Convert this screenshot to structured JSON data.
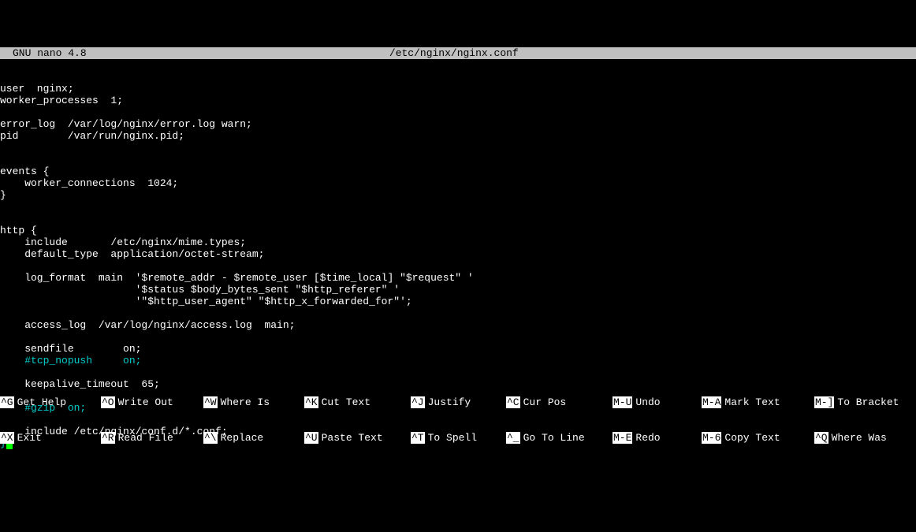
{
  "header": {
    "app": "GNU nano 4.8",
    "filename": "/etc/nginx/nginx.conf"
  },
  "lines": [
    {
      "t": "user  nginx;"
    },
    {
      "t": "worker_processes  1;"
    },
    {
      "t": ""
    },
    {
      "t": "error_log  /var/log/nginx/error.log warn;"
    },
    {
      "t": "pid        /var/run/nginx.pid;"
    },
    {
      "t": ""
    },
    {
      "t": ""
    },
    {
      "t": "events {"
    },
    {
      "t": "    worker_connections  1024;"
    },
    {
      "t": "}"
    },
    {
      "t": ""
    },
    {
      "t": ""
    },
    {
      "t": "http {"
    },
    {
      "t": "    include       /etc/nginx/mime.types;"
    },
    {
      "t": "    default_type  application/octet-stream;"
    },
    {
      "t": ""
    },
    {
      "t": "    log_format  main  '$remote_addr - $remote_user [$time_local] \"$request\" '"
    },
    {
      "t": "                      '$status $body_bytes_sent \"$http_referer\" '"
    },
    {
      "t": "                      '\"$http_user_agent\" \"$http_x_forwarded_for\"';"
    },
    {
      "t": ""
    },
    {
      "t": "    access_log  /var/log/nginx/access.log  main;"
    },
    {
      "t": ""
    },
    {
      "t": "    sendfile        on;"
    },
    {
      "t": "    #tcp_nopush     on;",
      "c": true,
      "indent": "    "
    },
    {
      "t": ""
    },
    {
      "t": "    keepalive_timeout  65;"
    },
    {
      "t": ""
    },
    {
      "t": "    #gzip  on;",
      "c": true,
      "indent": "    "
    },
    {
      "t": ""
    },
    {
      "t": "    include /etc/nginx/conf.d/*.conf;"
    },
    {
      "t": "}",
      "cursor": true
    }
  ],
  "shortcuts": {
    "row1": [
      {
        "k": "^G",
        "d": "Get Help"
      },
      {
        "k": "^O",
        "d": "Write Out"
      },
      {
        "k": "^W",
        "d": "Where Is"
      },
      {
        "k": "^K",
        "d": "Cut Text"
      },
      {
        "k": "^J",
        "d": "Justify"
      },
      {
        "k": "^C",
        "d": "Cur Pos"
      },
      {
        "k": "M-U",
        "d": "Undo"
      },
      {
        "k": "M-A",
        "d": "Mark Text"
      },
      {
        "k": "M-]",
        "d": "To Bracket"
      }
    ],
    "row2": [
      {
        "k": "^X",
        "d": "Exit"
      },
      {
        "k": "^R",
        "d": "Read File"
      },
      {
        "k": "^\\",
        "d": "Replace"
      },
      {
        "k": "^U",
        "d": "Paste Text"
      },
      {
        "k": "^T",
        "d": "To Spell"
      },
      {
        "k": "^_",
        "d": "Go To Line"
      },
      {
        "k": "M-E",
        "d": "Redo"
      },
      {
        "k": "M-6",
        "d": "Copy Text"
      },
      {
        "k": "^Q",
        "d": "Where Was"
      }
    ]
  }
}
